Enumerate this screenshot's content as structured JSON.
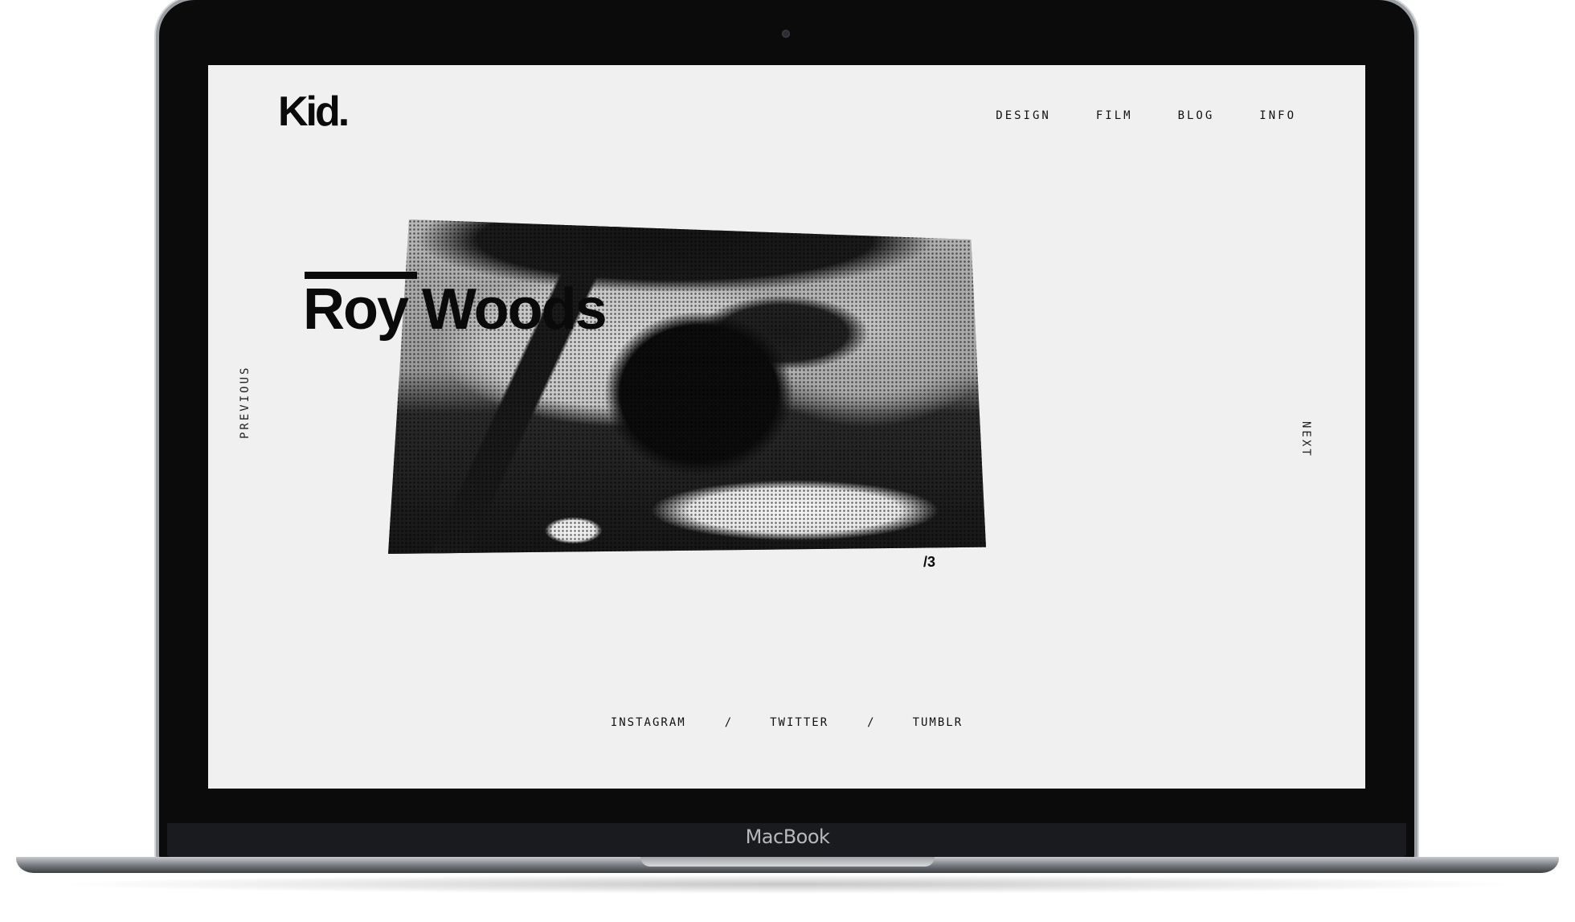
{
  "device": {
    "brand_label": "MacBook"
  },
  "site": {
    "logo": "Kid.",
    "nav": [
      {
        "label": "DESIGN"
      },
      {
        "label": "FILM"
      },
      {
        "label": "BLOG"
      },
      {
        "label": "INFO"
      }
    ],
    "prev_label": "PREVIOUS",
    "next_label": "NEXT"
  },
  "feature": {
    "title": "Roy Woods",
    "counter": "/3",
    "image": "halftone black-and-white photo of person in car"
  },
  "footer": {
    "links": [
      {
        "label": "INSTAGRAM"
      },
      {
        "label": "TWITTER"
      },
      {
        "label": "TUMBLR"
      }
    ],
    "separator": "/"
  }
}
